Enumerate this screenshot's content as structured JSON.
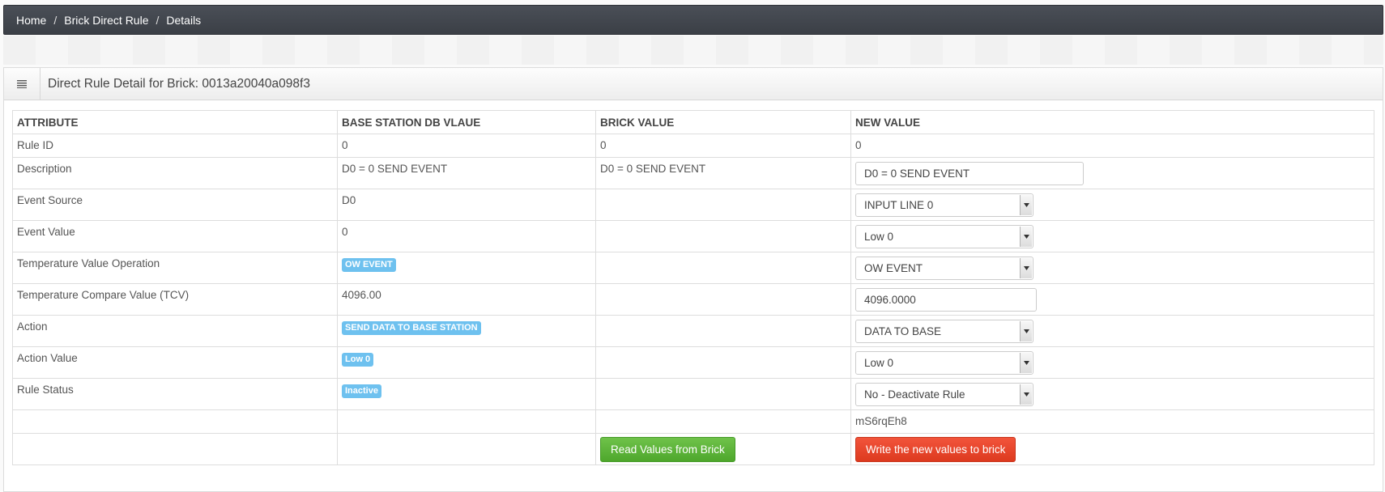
{
  "breadcrumb": [
    "Home",
    "Brick Direct Rule",
    "Details"
  ],
  "panel": {
    "title": "Direct Rule Detail for Brick: 0013a20040a098f3",
    "menu_icon": "list-icon"
  },
  "table": {
    "headers": [
      "ATTRIBUTE",
      "BASE STATION DB VLAUE",
      "BRICK VALUE",
      "NEW VALUE"
    ],
    "rows": [
      {
        "attribute": "Rule ID",
        "db": "0",
        "brick": "0",
        "new": "0"
      },
      {
        "attribute": "Description",
        "db": "D0 = 0 SEND EVENT",
        "brick": "D0 = 0 SEND EVENT",
        "new": "D0 = 0 SEND EVENT"
      },
      {
        "attribute": "Event Source",
        "db": "D0",
        "brick": "",
        "new": "INPUT LINE 0"
      },
      {
        "attribute": "Event Value",
        "db": "0",
        "brick": "",
        "new": "Low 0"
      },
      {
        "attribute": "Temperature Value Operation",
        "db": "OW EVENT",
        "brick": "",
        "new": "OW EVENT"
      },
      {
        "attribute": "Temperature Compare Value (TCV)",
        "db": "4096.00",
        "brick": "",
        "new": "4096.0000"
      },
      {
        "attribute": "Action",
        "db": "SEND DATA TO BASE STATION",
        "brick": "",
        "new": "DATA TO BASE"
      },
      {
        "attribute": "Action Value",
        "db": "Low 0",
        "brick": "",
        "new": "Low 0"
      },
      {
        "attribute": "Rule Status",
        "db": "Inactive",
        "brick": "",
        "new": "No - Deactivate Rule"
      },
      {
        "attribute": "",
        "db": "",
        "brick": "",
        "new": "mS6rqEh8"
      }
    ]
  },
  "buttons": {
    "read": "Read Values from Brick",
    "write": "Write the new values to brick"
  },
  "colors": {
    "badge": "#6ec1ef",
    "read_button": "#5cb536",
    "write_button": "#e8482d",
    "breadcrumb_bar": "#43474e"
  }
}
